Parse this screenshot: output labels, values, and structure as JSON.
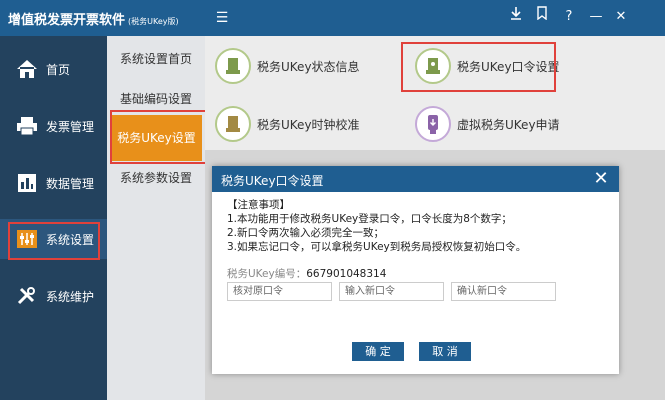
{
  "titlebar": {
    "app_title": "增值税发票开票软件",
    "app_subtitle": "(税务UKey版)",
    "buttons": [
      "download",
      "bookmark",
      "help",
      "minimize",
      "close"
    ]
  },
  "leftnav": {
    "items": [
      {
        "label": "首页",
        "icon": "home-icon"
      },
      {
        "label": "发票管理",
        "icon": "printer-icon"
      },
      {
        "label": "数据管理",
        "icon": "data-icon"
      },
      {
        "label": "系统设置",
        "icon": "settings-sliders-icon"
      },
      {
        "label": "系统维护",
        "icon": "tools-icon"
      }
    ],
    "active_index": 3
  },
  "subnav": {
    "items": [
      {
        "label": "系统设置首页"
      },
      {
        "label": "基础编码设置"
      },
      {
        "label": "税务UKey设置"
      },
      {
        "label": "系统参数设置"
      }
    ],
    "active_index": 2
  },
  "main": {
    "cards": [
      {
        "label": "税务UKey状态信息",
        "icon": "ukey-status-icon"
      },
      {
        "label": "税务UKey口令设置",
        "icon": "ukey-password-icon"
      },
      {
        "label": "税务UKey时钟校准",
        "icon": "ukey-clock-icon"
      },
      {
        "label": "虚拟税务UKey申请",
        "icon": "virtual-ukey-icon"
      }
    ]
  },
  "dialog": {
    "title": "税务UKey口令设置",
    "notice": [
      "【注意事项】",
      "1.本功能用于修改税务UKey登录口令，口令长度为8个数字；",
      "2.新口令两次输入必须完全一致；",
      "3.如果忘记口令，可以拿税务UKey到税务局授权恢复初始口令。"
    ],
    "serial_label": "税务UKey编号：",
    "serial_value": "667901048314",
    "fields": {
      "old_placeholder": "核对原口令",
      "new_placeholder": "输入新口令",
      "confirm_placeholder": "确认新口令"
    },
    "confirm_label": "确 定",
    "cancel_label": "取 消"
  },
  "colors": {
    "titlebar": "#1f5e91",
    "leftnav": "#23425e",
    "subnav": "#e3e5e8",
    "active_sub": "#e8901a",
    "highlight": "#e0413b",
    "main_bg": "#ececec"
  }
}
